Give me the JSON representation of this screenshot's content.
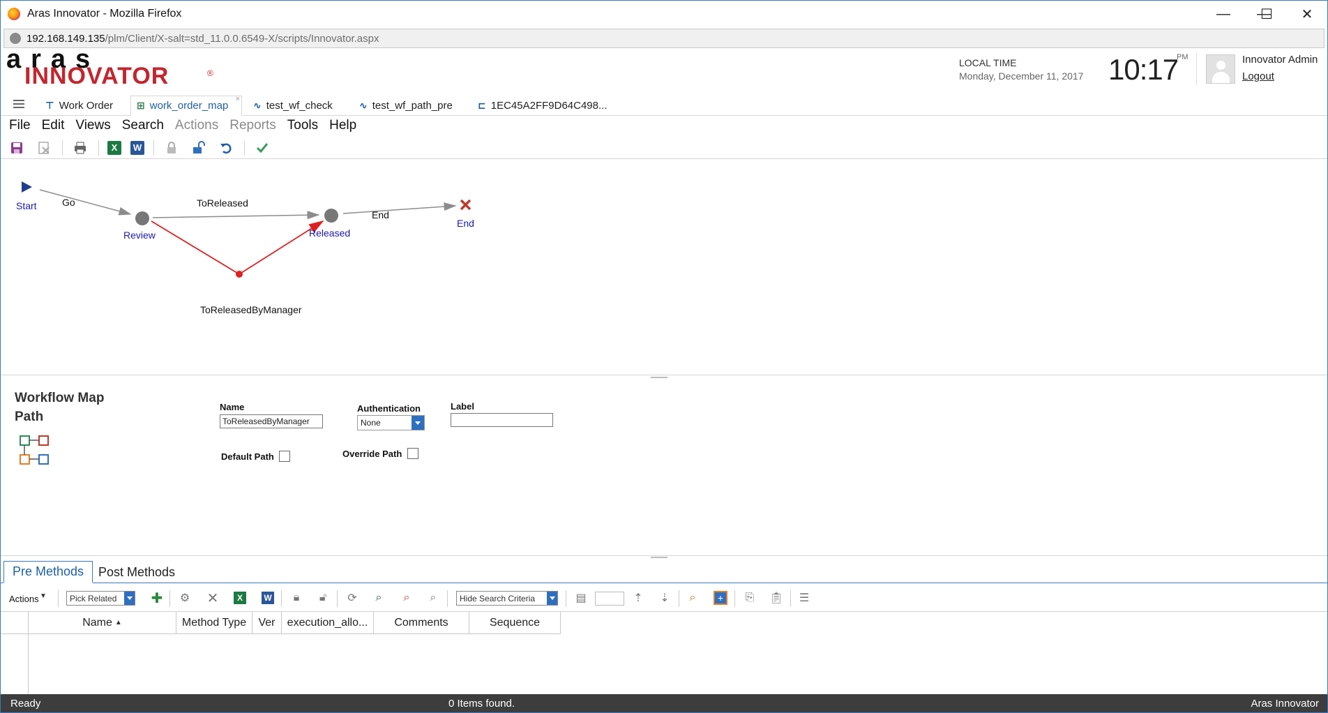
{
  "window": {
    "title": "Aras Innovator - Mozilla Firefox",
    "controls": {
      "minimize": "—",
      "maximize": "☐",
      "close": "✕"
    }
  },
  "address": {
    "host": "192.168.149.135",
    "path": "/plm/Client/X-salt=std_11.0.0.6549-X/scripts/Innovator.aspx"
  },
  "header": {
    "logo_top": "aras",
    "logo_bottom": "INNOVATOR",
    "logo_reg": "®",
    "local_time_label": "LOCAL TIME",
    "date": "Monday, December 11, 2017",
    "time": "10:17",
    "ampm": "PM",
    "user": "Innovator Admin",
    "logout": "Logout"
  },
  "tabs": [
    {
      "label": "Work Order",
      "icon": "work-order-icon"
    },
    {
      "label": "work_order_map",
      "icon": "workflow-map-icon",
      "active": true
    },
    {
      "label": "test_wf_check",
      "icon": "workflow-icon"
    },
    {
      "label": "test_wf_path_pre",
      "icon": "workflow-icon"
    },
    {
      "label": "1EC45A2FF9D64C498...",
      "icon": "item-icon"
    }
  ],
  "menu": [
    {
      "label": "File",
      "enabled": true
    },
    {
      "label": "Edit",
      "enabled": true
    },
    {
      "label": "Views",
      "enabled": true
    },
    {
      "label": "Search",
      "enabled": true
    },
    {
      "label": "Actions",
      "enabled": false
    },
    {
      "label": "Reports",
      "enabled": false
    },
    {
      "label": "Tools",
      "enabled": true
    },
    {
      "label": "Help",
      "enabled": true
    }
  ],
  "toolbar": {
    "icons": [
      "save-icon",
      "discard-icon",
      "print-icon",
      "excel-icon",
      "word-icon",
      "lock-icon",
      "unlock-icon",
      "undo-icon",
      "done-icon"
    ],
    "excel_glyph": "X",
    "word_glyph": "W"
  },
  "diagram": {
    "nodes": {
      "start": "Start",
      "review": "Review",
      "released": "Released",
      "end": "End"
    },
    "paths": {
      "go": "Go",
      "to_released": "ToReleased",
      "end": "End",
      "by_manager": "ToReleasedByManager"
    },
    "colors": {
      "path": "#8c8c8c",
      "selected_path": "#e02020",
      "node": "#777777",
      "start": "#1f3f8f",
      "end": "#c0392b"
    }
  },
  "form": {
    "title": "Workflow Map Path",
    "name_label": "Name",
    "name_value": "ToReleasedByManager",
    "authentication_label": "Authentication",
    "authentication_value": "None",
    "label_label": "Label",
    "label_value": "",
    "default_path_label": "Default Path",
    "default_path_checked": false,
    "override_path_label": "Override Path",
    "override_path_checked": false
  },
  "relationships": {
    "tabs": [
      {
        "label": "Pre Methods",
        "active": true
      },
      {
        "label": "Post Methods"
      }
    ],
    "actions_label": "Actions",
    "pick_related": "Pick Related",
    "search_mode": "Hide Search Criteria",
    "page_value": "",
    "columns": [
      "Name",
      "Method Type",
      "Ver",
      "execution_allo...",
      "Comments",
      "Sequence"
    ],
    "sort_indicator": "▲",
    "rows": []
  },
  "status": {
    "state": "Ready",
    "items_found": "0 Items found.",
    "app": "Aras Innovator"
  }
}
